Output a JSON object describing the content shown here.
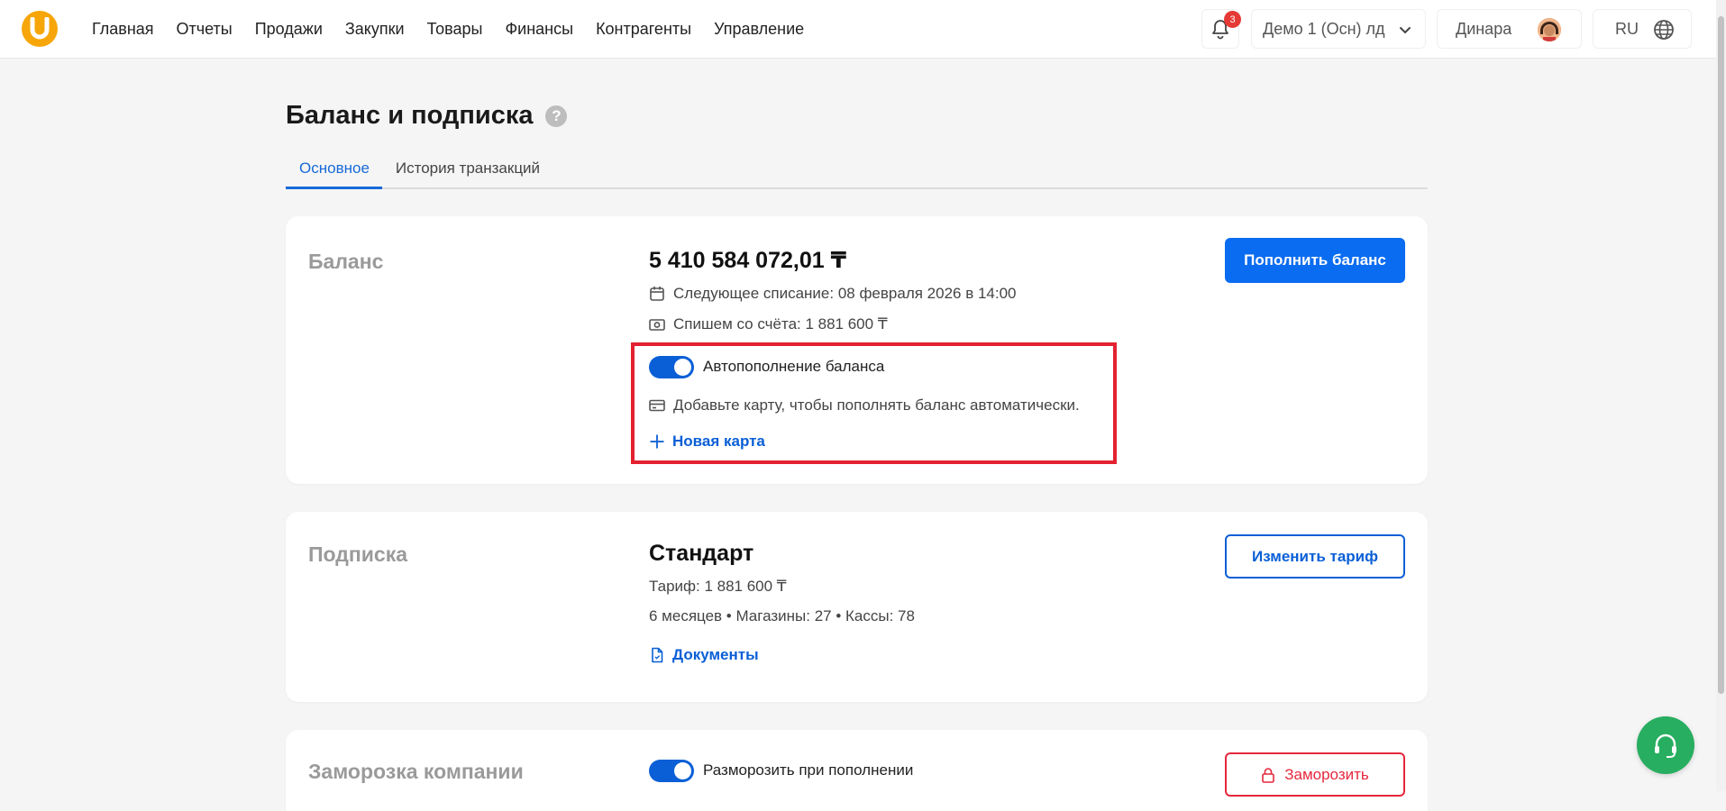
{
  "header": {
    "nav": [
      "Главная",
      "Отчеты",
      "Продажи",
      "Закупки",
      "Товары",
      "Финансы",
      "Контрагенты",
      "Управление"
    ],
    "notifications_count": "3",
    "company": "Демо 1 (Осн) лд",
    "user_name": "Динара",
    "language": "RU"
  },
  "page": {
    "title": "Баланс и подписка",
    "help": "?",
    "tabs": [
      "Основное",
      "История транзакций"
    ]
  },
  "balance": {
    "label": "Баланс",
    "amount": "5 410 584 072,01 ₸",
    "next_charge": "Следующее списание: 08 февраля 2026 в 14:00",
    "charge_amount": "Спишем со счёта: 1 881 600 ₸",
    "topup_button": "Пополнить баланс",
    "autotopup_label": "Автопополнение баланса",
    "autotopup_enabled": true,
    "card_hint": "Добавьте карту, чтобы пополнять баланс автоматически.",
    "new_card": "Новая карта"
  },
  "subscription": {
    "label": "Подписка",
    "plan": "Стандарт",
    "tariff": "Тариф: 1 881 600 ₸",
    "details": "6 месяцев • Магазины: 27 • Кассы: 78",
    "documents": "Документы",
    "change_button": "Изменить тариф"
  },
  "freeze": {
    "label": "Заморозка компании",
    "unfreeze_label": "Разморозить при пополнении",
    "unfreeze_enabled": true,
    "freeze_button": "Заморозить"
  },
  "colors": {
    "accent": "#0a6cf0",
    "danger": "#e5273c",
    "logo": "#f6a609",
    "support": "#27ae60"
  }
}
